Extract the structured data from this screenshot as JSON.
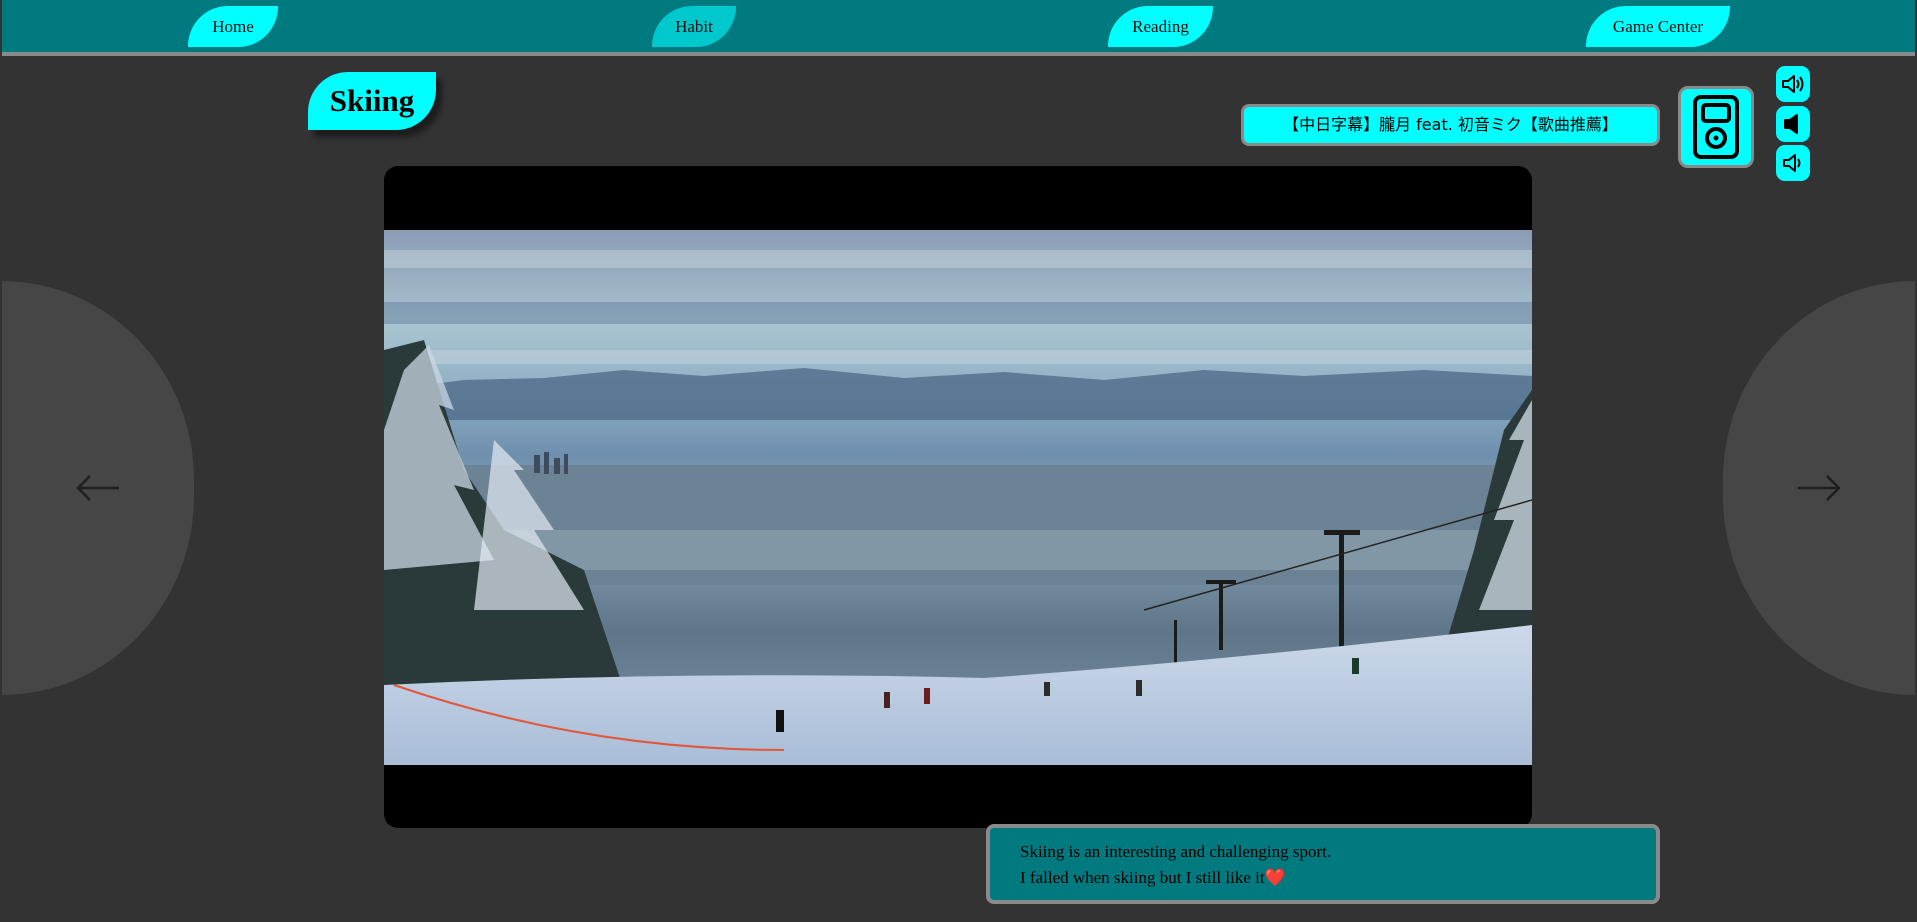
{
  "nav": {
    "tabs": [
      {
        "label": "Home",
        "active": false
      },
      {
        "label": "Habit",
        "active": true
      },
      {
        "label": "Reading",
        "active": false
      },
      {
        "label": "Game Center",
        "active": false
      }
    ]
  },
  "page": {
    "title": "Skiing"
  },
  "music": {
    "song_title": "【中日字幕】朧月 feat. 初音ミク【歌曲推薦】",
    "player_icon": "music-player-icon",
    "controls": [
      "volume-up-icon",
      "volume-mute-icon",
      "volume-down-icon"
    ]
  },
  "carousel": {
    "prev_icon": "arrow-left-icon",
    "next_icon": "arrow-right-icon"
  },
  "caption": {
    "line1": "Skiing is an interesting and challenging sport.",
    "line2": "I falled when skiing but I still like it",
    "emoji": "❤️"
  },
  "colors": {
    "accent": "#00ffff",
    "navbar": "#007a7e",
    "background": "#333333",
    "border": "#8a8a8a"
  }
}
